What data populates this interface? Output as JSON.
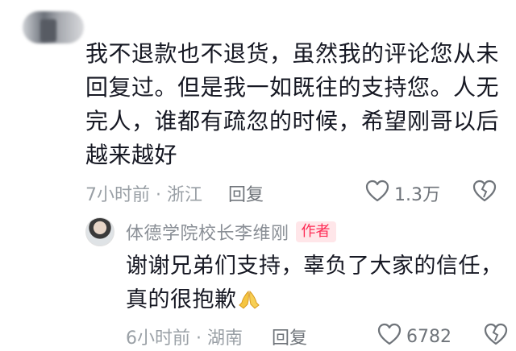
{
  "comment": {
    "text": "我不退款也不退货，虽然我的评论您从未回复过。但是我一如既往的支持您。人无完人，谁都有疏忽的时候，希望刚哥以后越来越好",
    "time_location": "7小时前 · 浙江",
    "reply_label": "回复",
    "likes": "1.3万"
  },
  "reply": {
    "author_name": "体德学院校长李维刚",
    "author_badge": "作者",
    "text": "谢谢兄弟们支持，辜负了大家的信任，真的很抱歉",
    "emoji_name": "praying-hands-emoji",
    "time_location": "6小时前 · 湖南",
    "reply_label": "回复",
    "likes": "6782"
  },
  "icons": {
    "like": "heart-outline-icon",
    "dislike": "broken-heart-icon"
  },
  "colors": {
    "text_primary": "#161823",
    "text_secondary": "#9aa0a6",
    "author_badge": "#fe2c55"
  }
}
